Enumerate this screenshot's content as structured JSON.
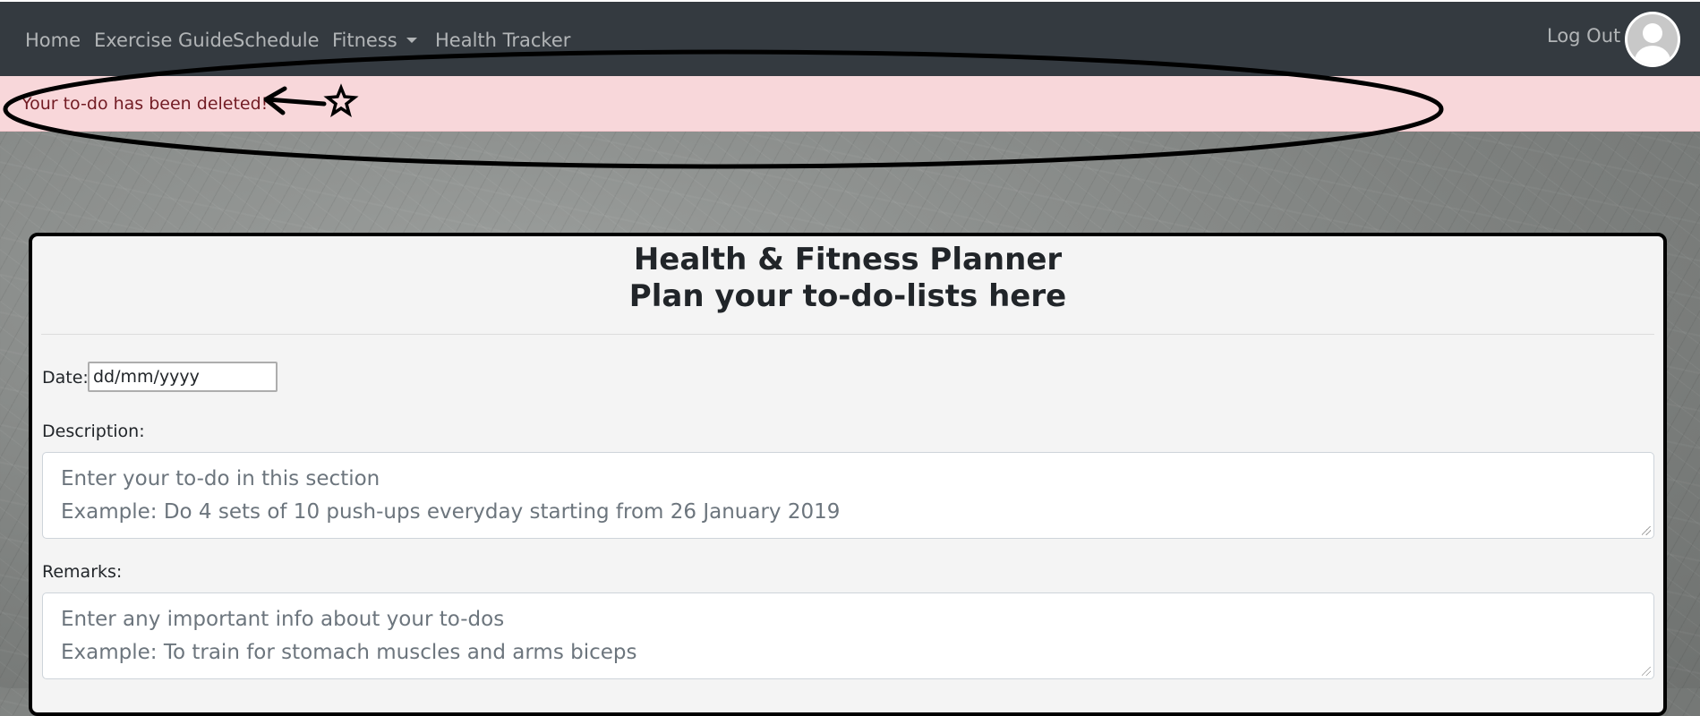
{
  "nav": {
    "items": [
      {
        "label": "Home"
      },
      {
        "label": "Exercise Guide"
      },
      {
        "label": "Schedule"
      },
      {
        "label": "Fitness",
        "has_dropdown": true
      },
      {
        "label": "Health Tracker"
      }
    ],
    "logout_label": "Log Out",
    "avatar_icon": "user-avatar-icon",
    "background": "#343a40"
  },
  "alert": {
    "message": "Your to-do has been deleted!",
    "background": "#f8d7da",
    "text_color": "#721c24"
  },
  "annotation": {
    "arrow_icon": "arrow-left-icon",
    "star_icon": "star-icon"
  },
  "card": {
    "title_line1": "Health & Fitness Planner",
    "title_line2": "Plan your to-do-lists here",
    "date": {
      "label": "Date:",
      "value": "dd/mm/yyyy"
    },
    "description": {
      "label": "Description:",
      "placeholder_line1": "Enter your to-do in this section",
      "placeholder_line2": "Example: Do 4 sets of 10 push-ups everyday starting from 26 January 2019"
    },
    "remarks": {
      "label": "Remarks:",
      "placeholder_line1": "Enter any important info about your to-dos",
      "placeholder_line2": "Example: To train for stomach muscles and arms biceps"
    }
  }
}
